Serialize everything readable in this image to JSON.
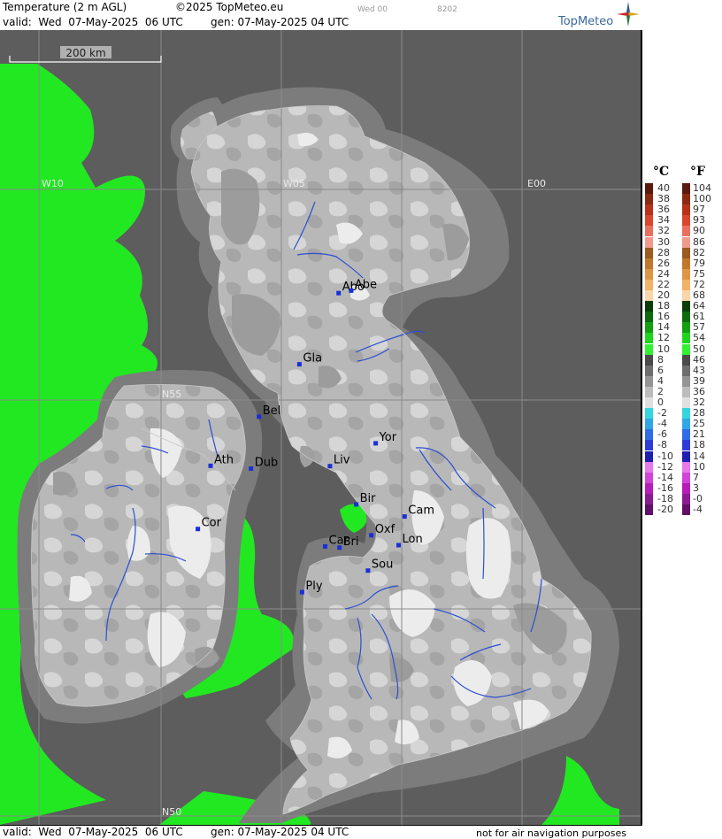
{
  "header": {
    "title": "Temperature (2 m AGL)",
    "copyright": "©2025 TopMeteo.eu",
    "step": "Wed 00",
    "code": "8202",
    "valid": "valid:  Wed  07-May-2025  06 UTC",
    "gen": "gen: 07-May-2025 04 UTC",
    "brand": "TopMeteo"
  },
  "footer": {
    "valid": "valid:  Wed  07-May-2025  06 UTC",
    "gen": "gen: 07-May-2025 04 UTC",
    "disclaimer": "not for air navigation purposes"
  },
  "map": {
    "scale_label": "200 km",
    "grid_labels": {
      "w10": "W10",
      "w05": "W05",
      "e00": "E00",
      "n55": "N55",
      "n50": "N50"
    },
    "cities": [
      {
        "name": "Abo",
        "lon": -2.62,
        "lat": 57.57
      },
      {
        "name": "Abe",
        "lon": -2.1,
        "lat": 57.63
      },
      {
        "name": "Gla",
        "lon": -4.25,
        "lat": 55.86
      },
      {
        "name": "Bel",
        "lon": -5.93,
        "lat": 54.6
      },
      {
        "name": "Yor",
        "lon": -1.08,
        "lat": 53.96
      },
      {
        "name": "Ath",
        "lon": -7.94,
        "lat": 53.42
      },
      {
        "name": "Dub",
        "lon": -6.26,
        "lat": 53.35
      },
      {
        "name": "Liv",
        "lon": -2.98,
        "lat": 53.41
      },
      {
        "name": "Bir",
        "lon": -1.89,
        "lat": 52.49
      },
      {
        "name": "Cam",
        "lon": 0.12,
        "lat": 52.2
      },
      {
        "name": "Cor",
        "lon": -8.47,
        "lat": 51.9
      },
      {
        "name": "Oxf",
        "lon": -1.26,
        "lat": 51.75
      },
      {
        "name": "Car",
        "lon": -3.18,
        "lat": 51.48
      },
      {
        "name": "Bri",
        "lon": -2.59,
        "lat": 51.45
      },
      {
        "name": "Lon",
        "lon": -0.13,
        "lat": 51.51
      },
      {
        "name": "Sou",
        "lon": -1.4,
        "lat": 50.9
      },
      {
        "name": "Ply",
        "lon": -4.14,
        "lat": 50.38
      }
    ]
  },
  "legend": {
    "celsius_header": "°C",
    "fahrenheit_header": "°F",
    "celsius": [
      "40",
      "38",
      "36",
      "34",
      "32",
      "30",
      "28",
      "26",
      "24",
      "22",
      "20",
      "18",
      "16",
      "14",
      "12",
      "10",
      "8",
      "6",
      "4",
      "2",
      "0",
      "-2",
      "-4",
      "-6",
      "-8",
      "-10",
      "-12",
      "-14",
      "-16",
      "-18",
      "-20"
    ],
    "fahrenheit": [
      "104",
      "100",
      "97",
      "93",
      "90",
      "86",
      "82",
      "79",
      "75",
      "72",
      "68",
      "64",
      "61",
      "57",
      "54",
      "50",
      "46",
      "43",
      "39",
      "36",
      "32",
      "28",
      "25",
      "21",
      "18",
      "14",
      "10",
      "7",
      "3",
      "-0",
      "-4"
    ],
    "colors": [
      "#5a1a0e",
      "#8b2a12",
      "#b8321b",
      "#d9462b",
      "#e97060",
      "#f29a8e",
      "#9b5a1e",
      "#c0782c",
      "#de9646",
      "#f3b266",
      "#f9d5aa",
      "#0a3d0a",
      "#0d6b0d",
      "#12a012",
      "#1ed41e",
      "#32f032",
      "#4a4a4a",
      "#6e6e6e",
      "#949494",
      "#bcbcbc",
      "#e0e0e0",
      "#33d6dc",
      "#2fa6e6",
      "#2f6ce8",
      "#2e3cd8",
      "#1f1fb0",
      "#e879ec",
      "#d044d8",
      "#b61db8",
      "#8a1a90",
      "#601068"
    ]
  }
}
